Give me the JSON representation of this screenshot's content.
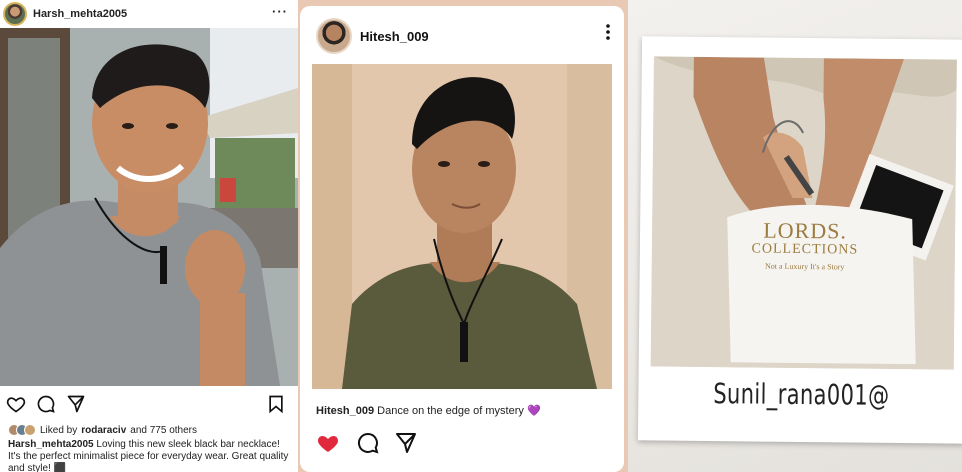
{
  "posts": [
    {
      "username": "Harsh_mehta2005",
      "menu_glyph": "···",
      "liked_by_prefix": "Liked by ",
      "liked_by_user": "rodaraciv",
      "liked_by_suffix": " and 775 others",
      "caption_user": "Harsh_mehta2005",
      "caption_text": " Loving this new sleek black bar necklace! It's the perfect minimalist piece for everyday wear. Great quality and style! ⬛"
    },
    {
      "username": "Hitesh_009",
      "caption_user": "Hitesh_009",
      "caption_text": " Dance on the edge of mystery 💜",
      "like_color": "#e0293c"
    },
    {
      "signature": "Sunil_rana001@",
      "brand_line1": "LORDS.",
      "brand_line2": "COLLECTIONS",
      "brand_tagline": "Not a Luxury It's a Story"
    }
  ],
  "icons": [
    "heart-icon",
    "comment-icon",
    "share-icon",
    "bookmark-icon",
    "more-icon"
  ],
  "colors": {
    "accent_like": "#e0293c",
    "brand_gold": "#9b7b3f"
  }
}
